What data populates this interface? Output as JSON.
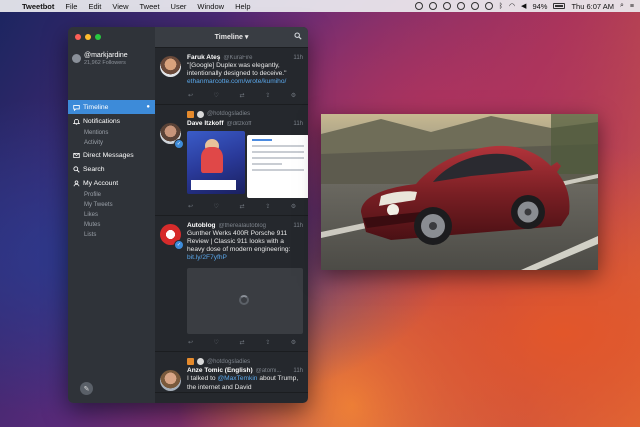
{
  "menubar": {
    "apple": "",
    "items": [
      "Tweetbot",
      "File",
      "Edit",
      "View",
      "Tweet",
      "User",
      "Window",
      "Help"
    ],
    "battery": "94%",
    "clock": "Thu 6:07 AM"
  },
  "sidebar": {
    "account_name": "@markjardine",
    "followers": "21,962 Followers",
    "nav": [
      {
        "label": "Timeline",
        "icon": "speech-bubble-icon"
      },
      {
        "label": "Notifications",
        "icon": "bell-icon"
      },
      {
        "label": "Mentions"
      },
      {
        "label": "Activity"
      },
      {
        "label": "Direct Messages",
        "icon": "envelope-icon"
      },
      {
        "label": "Search",
        "icon": "search-icon"
      },
      {
        "label": "My Account",
        "icon": "person-icon"
      },
      {
        "label": "Profile"
      },
      {
        "label": "My Tweets"
      },
      {
        "label": "Likes"
      },
      {
        "label": "Mutes"
      },
      {
        "label": "Lists"
      }
    ]
  },
  "column": {
    "title": "Timeline ▾"
  },
  "tweets": [
    {
      "name": "Faruk Ateş",
      "handle": "@KuraFire",
      "time": "11h",
      "text": "\"[Google] Duplex was elegantly, intentionally designed to deceive.\"",
      "link": "ethanmarcotte.com/wrote/kumiho/"
    },
    {
      "retweeted_by": "@hotdogsladies",
      "name": "Dave Itzkoff",
      "handle": "@ditzkoff",
      "time": "11h"
    },
    {
      "name": "Autoblog",
      "handle": "@therealautoblog",
      "time": "11h",
      "text": "Gunther Werks 400R Porsche 911 Review | Classic 911 looks with a heavy dose of modern engineering:",
      "link": "bit.ly/2F7yfhP"
    },
    {
      "retweeted_by": "@hotdogsladies",
      "name": "Anze Tomic (English)",
      "handle": "@atomi...",
      "time": "11h",
      "text_before": "I talked to ",
      "mention": "@MaxTemkin",
      "text_after": " about Trump, the internet and David"
    }
  ],
  "colors": {
    "accent": "#3d8bd9",
    "sidebar": "#2f3339",
    "column": "#25282d",
    "car": "#7a1f24"
  }
}
